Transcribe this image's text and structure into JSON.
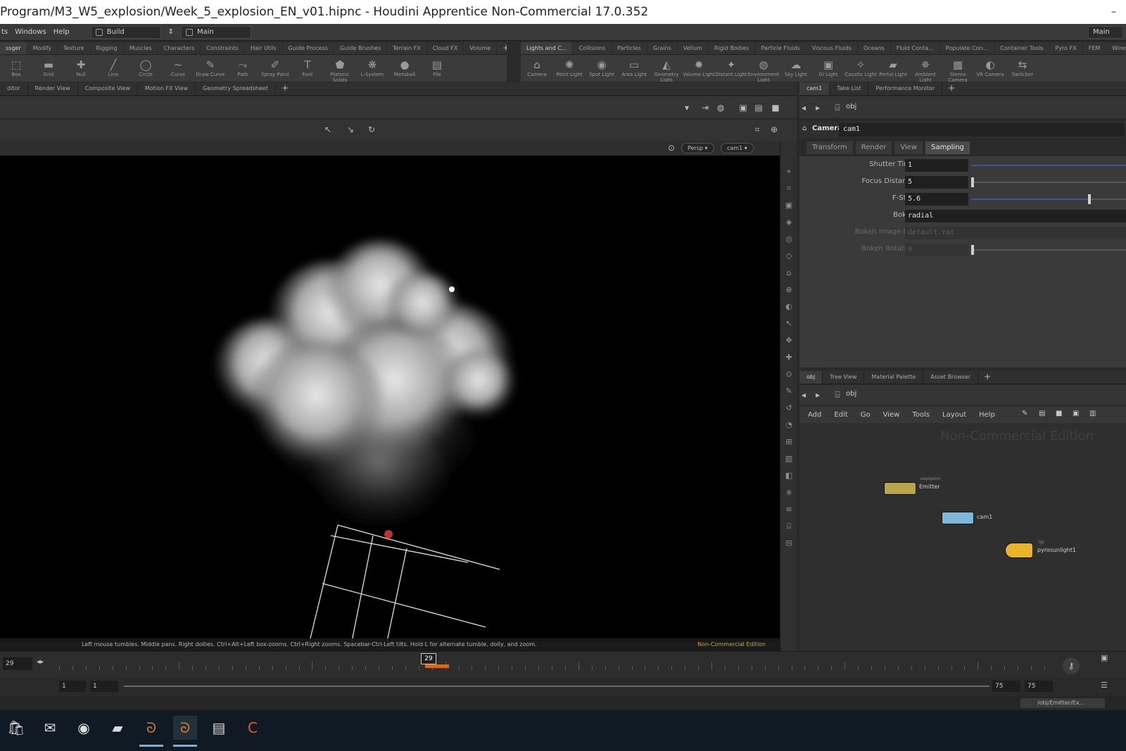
{
  "window": {
    "title": "Program/M3_W5_explosion/Week_5_explosion_EN_v01.hipnc - Houdini Apprentice Non-Commercial 17.0.352",
    "minimize": "–"
  },
  "menubar": {
    "items": [
      "ts",
      "Windows",
      "Help"
    ],
    "desktop": "Build",
    "desktop_arrow": "⇕",
    "main": "Main"
  },
  "shelf_tabs_left": [
    "ssger",
    "Modify",
    "Texture",
    "Rigging",
    "Muscles",
    "Characters",
    "Constraints",
    "Hair Utils",
    "Guide Process",
    "Guide Brushes",
    "Terrain FX",
    "Cloud FX",
    "Volume"
  ],
  "shelf_tabs_right": [
    "Lights and C...",
    "Collisions",
    "Particles",
    "Grains",
    "Vellum",
    "Rigid Bodies",
    "Particle Fluids",
    "Viscous Fluids",
    "Oceans",
    "Fluid Conta...",
    "Populate Con...",
    "Container Tools",
    "Pyro FX",
    "FEM",
    "Wires"
  ],
  "shelf_tools_left": [
    {
      "label": "Box",
      "glyph": "⬚"
    },
    {
      "label": "Grid",
      "glyph": "▬"
    },
    {
      "label": "Null",
      "glyph": "✚"
    },
    {
      "label": "Line",
      "glyph": "╱"
    },
    {
      "label": "Circle",
      "glyph": "◯"
    },
    {
      "label": "Curve",
      "glyph": "∼"
    },
    {
      "label": "Draw Curve",
      "glyph": "✎"
    },
    {
      "label": "Path",
      "glyph": "⤳"
    },
    {
      "label": "Spray Paint",
      "glyph": "✐"
    },
    {
      "label": "Font",
      "glyph": "T"
    },
    {
      "label": "Platonic Solids",
      "glyph": "⬟"
    },
    {
      "label": "L-System",
      "glyph": "❋"
    },
    {
      "label": "Metaball",
      "glyph": "●"
    },
    {
      "label": "File",
      "glyph": "▤"
    }
  ],
  "shelf_tools_right": [
    {
      "label": "Camera",
      "glyph": "⌂"
    },
    {
      "label": "Point Light",
      "glyph": "✺"
    },
    {
      "label": "Spot Light",
      "glyph": "◉"
    },
    {
      "label": "Area Light",
      "glyph": "▭"
    },
    {
      "label": "Geometry Light",
      "glyph": "◭"
    },
    {
      "label": "Volume Light",
      "glyph": "✹"
    },
    {
      "label": "Distant Light",
      "glyph": "✦"
    },
    {
      "label": "Environment Light",
      "glyph": "◍"
    },
    {
      "label": "Sky Light",
      "glyph": "☁"
    },
    {
      "label": "GI Light",
      "glyph": "▣"
    },
    {
      "label": "Caustic Light",
      "glyph": "✧"
    },
    {
      "label": "Portal Light",
      "glyph": "▰"
    },
    {
      "label": "Ambient Light",
      "glyph": "✵"
    },
    {
      "label": "Stereo Camera",
      "glyph": "▦"
    },
    {
      "label": "VR Camera",
      "glyph": "◐"
    },
    {
      "label": "Switcher",
      "glyph": "⇆"
    }
  ],
  "pane_tabs_left": [
    "ditor",
    "Render View",
    "Composite View",
    "Motion FX View",
    "Geometry Spreadsheet"
  ],
  "pane_tabs_right": [
    "cam1",
    "Take List",
    "Performance Monitor"
  ],
  "viewer": {
    "persp": "Persp ▾",
    "cam": "cam1 ▾"
  },
  "viewport": {
    "hint": "Left mouse tumbles. Middle pans. Right dollies. Ctrl+Alt+Left box-zooms. Ctrl+Right zooms. Spacebar-Ctrl-Left tilts. Hold L for alternate tumble, dolly, and zoom.",
    "watermark": "Non-Commercial Edition"
  },
  "params": {
    "path": "obj",
    "node_type": "Camera",
    "node_name": "cam1",
    "tabs": [
      "Transform",
      "Render",
      "View",
      "Sampling"
    ],
    "active_tab": "Sampling",
    "rows": [
      {
        "label": "Shutter Time",
        "value": "1",
        "slider": 1.0,
        "dim": false
      },
      {
        "label": "Focus Distance",
        "value": "5",
        "slider": 0.0,
        "dim": false
      },
      {
        "label": "F-Stop",
        "value": "5.6",
        "slider": 0.77,
        "dim": false
      },
      {
        "label": "Bokeh",
        "value": "radial",
        "dim": false
      },
      {
        "label": "Bokeh Image File",
        "value": "default.rat",
        "dim": true
      },
      {
        "label": "Bokeh Rotation",
        "value": "0",
        "slider": 0.0,
        "dim": true
      }
    ]
  },
  "network": {
    "tabs": [
      "obj",
      "Tree View",
      "Material Palette",
      "Asset Browser"
    ],
    "path": "obj",
    "menu": [
      "Add",
      "Edit",
      "Go",
      "View",
      "Tools",
      "Layout",
      "Help"
    ],
    "watermark": "Non-Commercial Edition",
    "nodes": [
      {
        "name": "Emitter",
        "sub": "explosion",
        "color": "#b9a64a"
      },
      {
        "name": "cam1",
        "sub": "",
        "color": "#7db8d8"
      },
      {
        "name": "pyrosunlight1",
        "sub": "lgt",
        "color": "#e9b42a"
      }
    ]
  },
  "timeline": {
    "frame": "29",
    "current": "29",
    "start": "1",
    "start2": "1",
    "end": "75",
    "end2": "75"
  },
  "statusline": {
    "path": "/obj/Emitter/Ex..."
  },
  "colors": {
    "accent": "#2c5aa0",
    "playbar": "#d86a12",
    "watermark": "#c9a43a"
  }
}
